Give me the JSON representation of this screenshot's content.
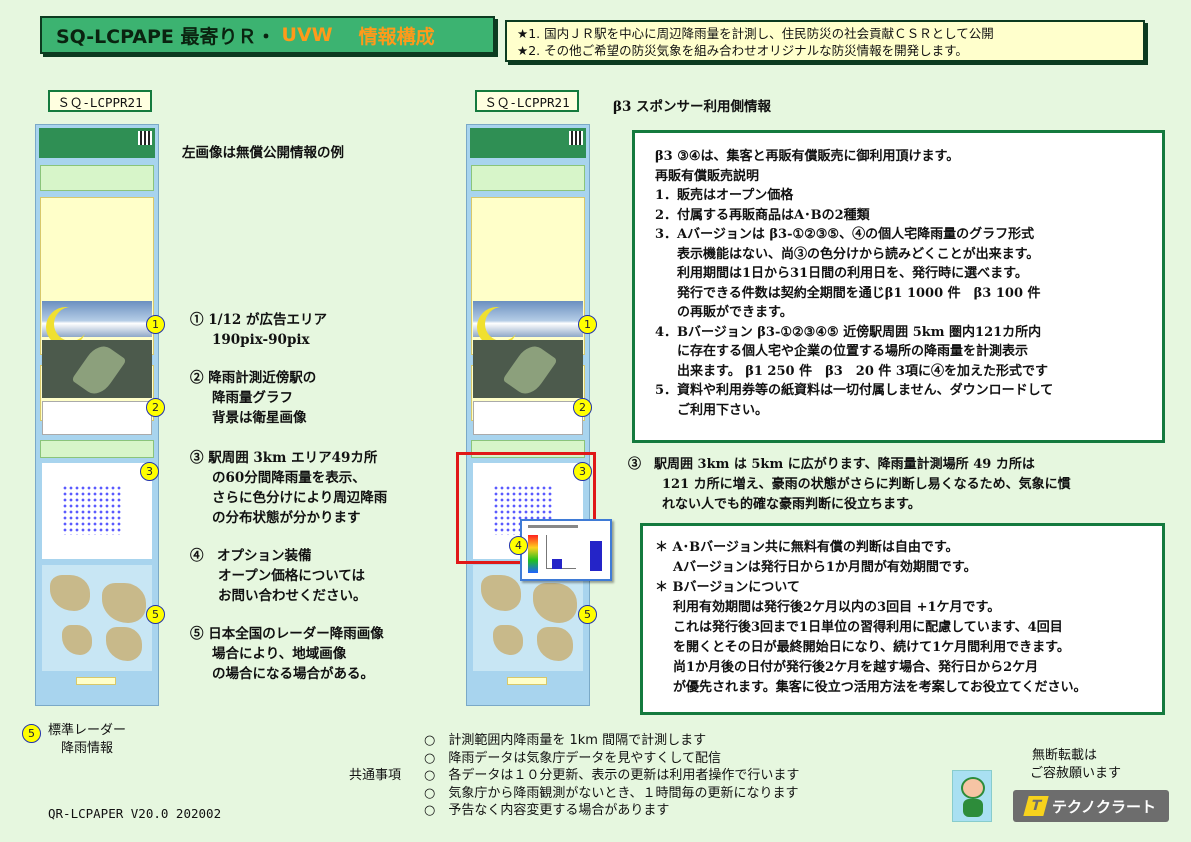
{
  "header": {
    "title_main": "SQ-LCPAPE 最寄りＲ・",
    "title_accent": "UVW",
    "title_section": "情報構成",
    "notes": [
      "★1. 国内ＪＲ駅を中心に周辺降雨量を計測し、住民防災の社会貢献ＣＳＲとして公開",
      "★2. その他ご希望の防災気象を組み合わせオリジナルな防災情報を開発します。"
    ]
  },
  "left_panel": {
    "label": "ＳＱ-LCPPR21",
    "caption": "左画像は無償公開情報の例",
    "items": [
      {
        "num": "1",
        "lines": [
          "① 1/12 が広告エリア",
          "190pix-90pix"
        ]
      },
      {
        "num": "2",
        "lines": [
          "② 降雨計測近傍駅の",
          "降雨量グラフ",
          "背景は衛星画像"
        ]
      },
      {
        "num": "3",
        "lines": [
          "③ 駅周囲 3km エリア49カ所",
          "の60分間降雨量を表示、",
          "さらに色分けにより周辺降雨",
          "の分布状態が分かります"
        ]
      },
      {
        "num": "4",
        "lines": [
          "④　オプション装備",
          "オープン価格については",
          "お問い合わせください。"
        ]
      },
      {
        "num": "5",
        "lines": [
          "⑤ 日本全国のレーダー降雨画像",
          "場合により、地域画像",
          "の場合になる場合がある。"
        ]
      }
    ],
    "legend_num": "5",
    "legend_text": [
      "標準レーダー",
      "降雨情報"
    ]
  },
  "mid_panel": {
    "label": "ＳＱ-LCPPR21",
    "markers": [
      "1",
      "2",
      "3",
      "4",
      "5"
    ]
  },
  "b3": {
    "heading": "β3 スポンサー利用側情報",
    "lines": [
      "β3 ③④は、集客と再販有償販売に御利用頂けます。",
      "再販有償販売説明",
      "1．販売はオープン価格",
      "2．付属する再販商品はA･Bの2種類",
      "3．Aバージョンは β3-①②③⑤、④の個人宅降雨量のグラフ形式",
      "表示機能はない、尚③の色分けから読みどくことが出来ます。",
      "利用期間は1日から31日間の利用日を、発行時に選べます。",
      "発行できる件数は契約全期間を通じβ1 1000 件　β3 100 件",
      "の再販ができます。",
      "4．Bバージョン β3-①②③④⑤ 近傍駅周囲 5km 圏内121カ所内",
      "に存在する個人宅や企業の位置する場所の降雨量を計測表示",
      "出来ます。 β1 250 件　β3　20 件 3項に④を加えた形式です",
      "5．資料や利用券等の紙資料は一切付属しません、ダウンロードして",
      "ご利用下さい。"
    ]
  },
  "item3": [
    "③　駅周囲 3km は 5km に広がります、降雨量計測場所 49 カ所は",
    "121 カ所に増え、豪雨の状態がさらに判断し易くなるため、気象に慣",
    "れない人でも的確な豪雨判断に役立ちます。"
  ],
  "notes_box": [
    "＊ A･Bバージョン共に無料有償の判断は自由です。",
    "Aバージョンは発行日から1か月間が有効期間です。",
    "＊ Bバージョンについて",
    "利用有効期間は発行後2ケ月以内の3回目 +1ケ月です。",
    "これは発行後3回まで1日単位の習得利用に配慮しています、4回目",
    "を開くとその日が最終開始日になり、続けて1ケ月間利用できます。",
    "尚1か月後の日付が発行後2ケ月を越す場合、発行日から2ケ月",
    "が優先されます。集客に役立つ活用方法を考案してお役立てください。"
  ],
  "common": {
    "label": "共通事項",
    "bullet": "○",
    "items": [
      "計測範囲内降雨量を 1km 間隔で計測します",
      "降雨データは気象庁データを見やすくして配信",
      "各データは１０分更新、表示の更新は利用者操作で行います",
      "気象庁から降雨観測がないとき、１時間毎の更新になります",
      "予告なく内容変更する場合があります"
    ]
  },
  "footer": {
    "version": "QR-LCPAPER V20.0 202002",
    "copyright": [
      "無断転載は",
      "ご容赦願います"
    ],
    "logo_text": "テクノクラート",
    "logo_mark": "T"
  },
  "colors": {
    "title_bg": "#3cb371",
    "accent": "#ff9a1a",
    "border_green": "#147a3e",
    "bg": "#e6f7df",
    "red": "#e01818"
  }
}
